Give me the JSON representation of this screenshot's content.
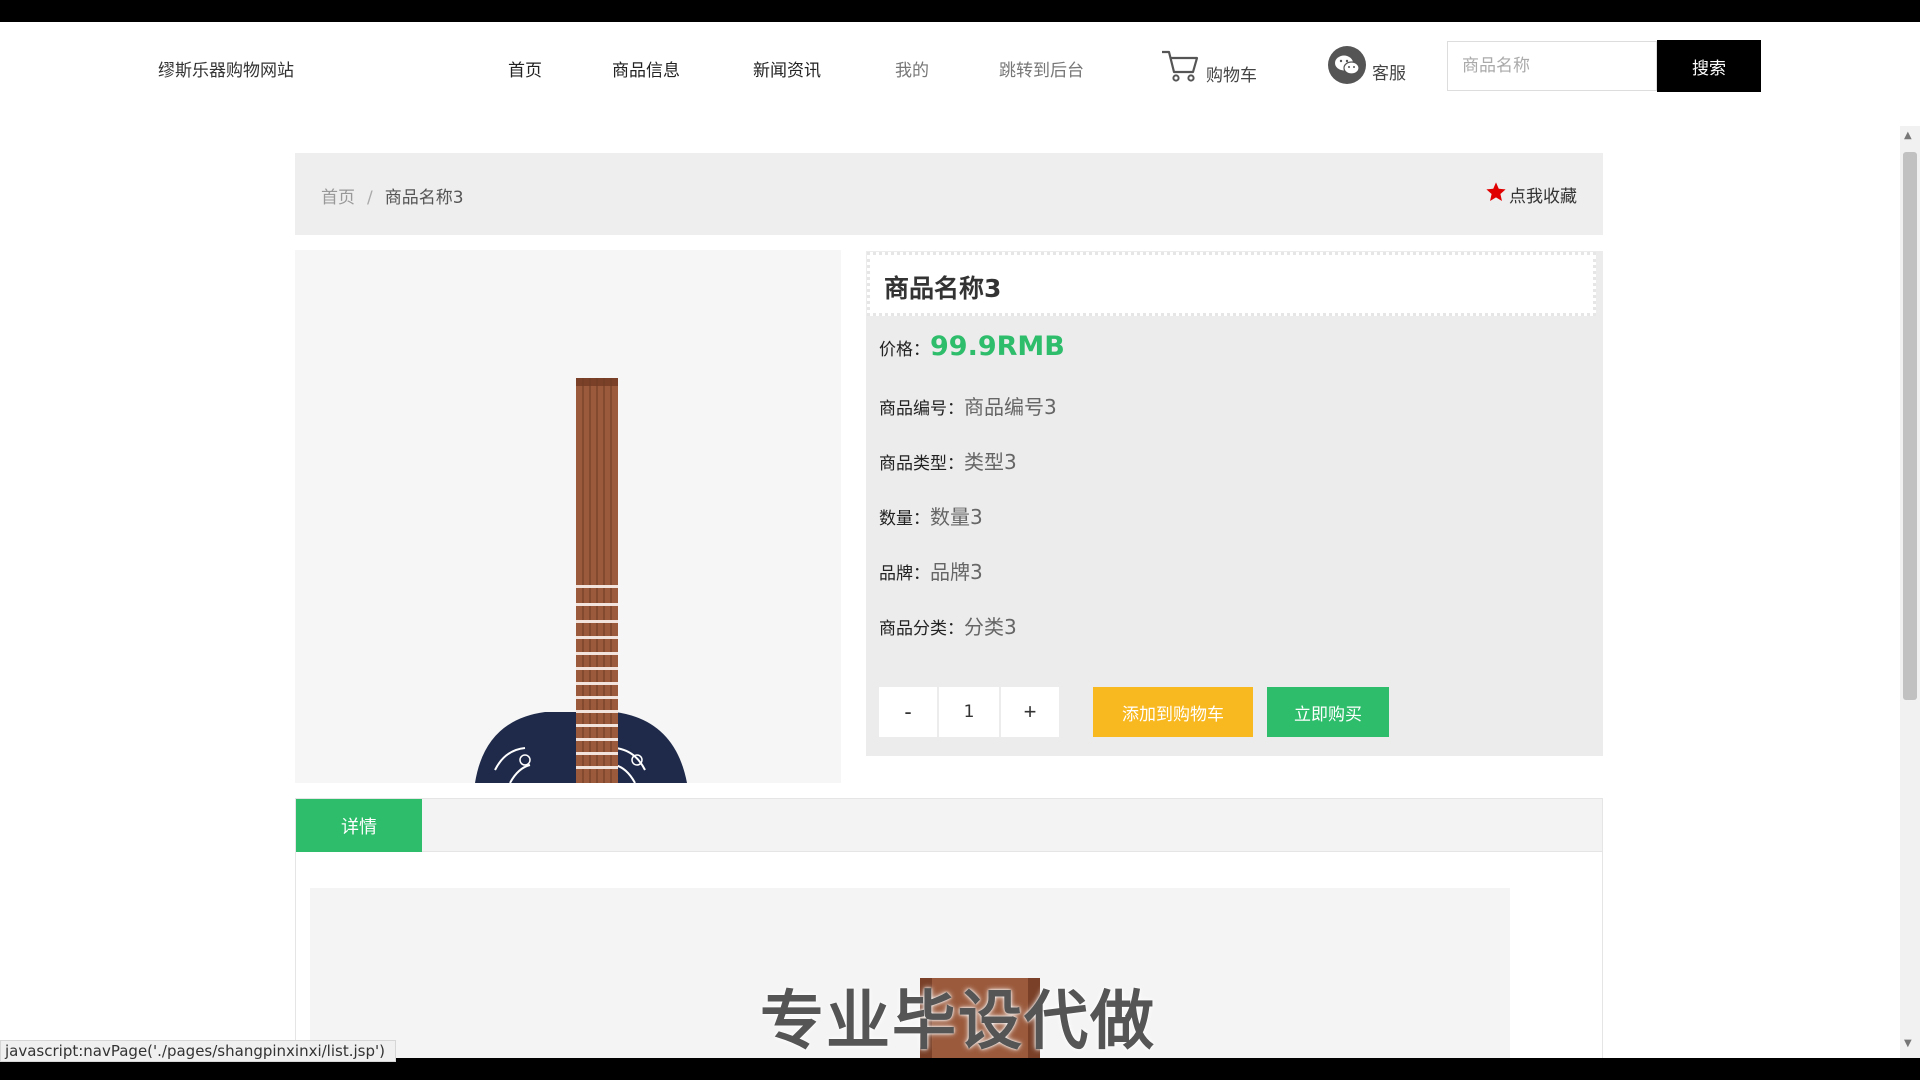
{
  "header": {
    "brand": "缪斯乐器购物网站",
    "nav": [
      {
        "label": "首页"
      },
      {
        "label": "商品信息"
      },
      {
        "label": "新闻资讯"
      },
      {
        "label": "我的"
      },
      {
        "label": "跳转到后台"
      }
    ],
    "cart_label": "购物车",
    "service_label": "客服",
    "search_placeholder": "商品名称",
    "search_button": "搜索"
  },
  "breadcrumb": {
    "home": "首页",
    "separator": "/",
    "current": "商品名称3",
    "favorite": "点我收藏"
  },
  "product": {
    "title": "商品名称3",
    "price_label": "价格：",
    "price": "99.9RMB",
    "code_label": "商品编号：",
    "code": "商品编号3",
    "type_label": "商品类型：",
    "type": "类型3",
    "quantity_label": "数量：",
    "quantity": "数量3",
    "brand_label": "品牌：",
    "brand": "品牌3",
    "category_label": "商品分类：",
    "category": "分类3"
  },
  "purchase": {
    "minus": "-",
    "qty": "1",
    "plus": "+",
    "add_to_cart": "添加到购物车",
    "buy_now": "立即购买"
  },
  "tabs": {
    "active": "详情"
  },
  "overlay": {
    "watermark": "专业毕设代做"
  },
  "status_bar": {
    "url": "javascript:navPage('./pages/shangpinxinxi/list.jsp')"
  },
  "colors": {
    "accent_green": "#2ebd6b",
    "add_cart_yellow": "#f8b820",
    "favorite_star": "#e00000"
  }
}
